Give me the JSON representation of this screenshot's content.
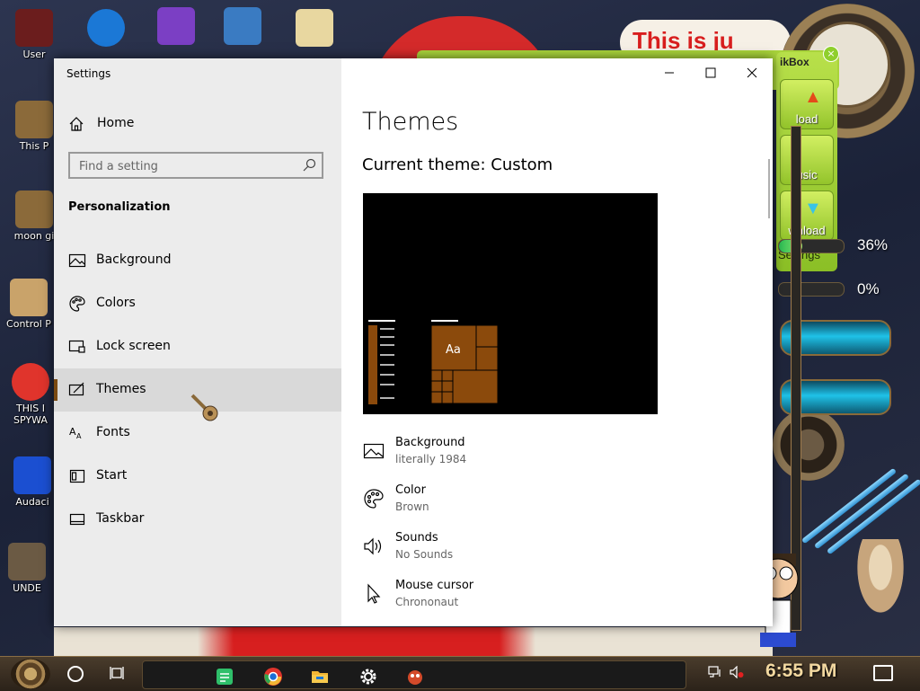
{
  "desktop": {
    "icons": [
      {
        "label": "User",
        "color": "#6b1d1d"
      },
      {
        "label": "This P",
        "color": "#8b6a3a"
      },
      {
        "label": "moon gi",
        "color": "#8b6a3a"
      },
      {
        "label": "Control P",
        "color": "#c9a36a"
      },
      {
        "label": "THIS I SPYWA",
        "color": "#e0342c"
      },
      {
        "label": "Audaci",
        "color": "#1b4fd1"
      },
      {
        "label": "UNDE",
        "color": "#6b5a44"
      }
    ],
    "top_icons": [
      {
        "label": "",
        "color": "#1b78d6"
      },
      {
        "label": "",
        "color": "#7b3fc4"
      },
      {
        "label": "",
        "color": "#3a7bc2"
      },
      {
        "label": "",
        "color": "#e8d7a0"
      }
    ],
    "banner_text": "This is ju",
    "widget": {
      "title": "ikBox",
      "buttons": [
        "load",
        "usic",
        "wnload"
      ],
      "settings_label": "Settings",
      "progress": [
        {
          "percent_label": "36%",
          "value": 36
        },
        {
          "percent_label": "0%",
          "value": 0
        }
      ]
    }
  },
  "window": {
    "title": "Settings",
    "controls": {
      "minimize": "minimize",
      "maximize": "maximize",
      "close": "close"
    },
    "sidebar": {
      "home_label": "Home",
      "search_placeholder": "Find a setting",
      "section_title": "Personalization",
      "items": [
        {
          "label": "Background",
          "icon": "picture-icon",
          "selected": false
        },
        {
          "label": "Colors",
          "icon": "palette-icon",
          "selected": false
        },
        {
          "label": "Lock screen",
          "icon": "lock-screen-icon",
          "selected": false
        },
        {
          "label": "Themes",
          "icon": "brush-icon",
          "selected": true
        },
        {
          "label": "Fonts",
          "icon": "font-icon",
          "selected": false
        },
        {
          "label": "Start",
          "icon": "start-icon",
          "selected": false
        },
        {
          "label": "Taskbar",
          "icon": "taskbar-icon",
          "selected": false
        }
      ]
    },
    "content": {
      "page_title": "Themes",
      "current_theme": "Current theme: Custom",
      "preview": {
        "sample_text": "Aa",
        "accent_color": "#8b4a0c"
      },
      "properties": [
        {
          "name": "Background",
          "value": "literally 1984",
          "icon": "picture-icon"
        },
        {
          "name": "Color",
          "value": "Brown",
          "icon": "palette-icon"
        },
        {
          "name": "Sounds",
          "value": "No Sounds",
          "icon": "speaker-icon"
        },
        {
          "name": "Mouse cursor",
          "value": "Chrononaut",
          "icon": "cursor-icon"
        }
      ]
    }
  },
  "taskbar": {
    "apps": [
      {
        "name": "sticky-notes-icon",
        "color": "#2fbf6a"
      },
      {
        "name": "chrome-icon",
        "color": "#e0342c"
      },
      {
        "name": "file-explorer-icon",
        "color": "#f2b634"
      },
      {
        "name": "settings-gear-icon",
        "color": "#ffffff"
      },
      {
        "name": "fox-app-icon",
        "color": "#d34a2a"
      }
    ],
    "time": "6:55 PM"
  }
}
